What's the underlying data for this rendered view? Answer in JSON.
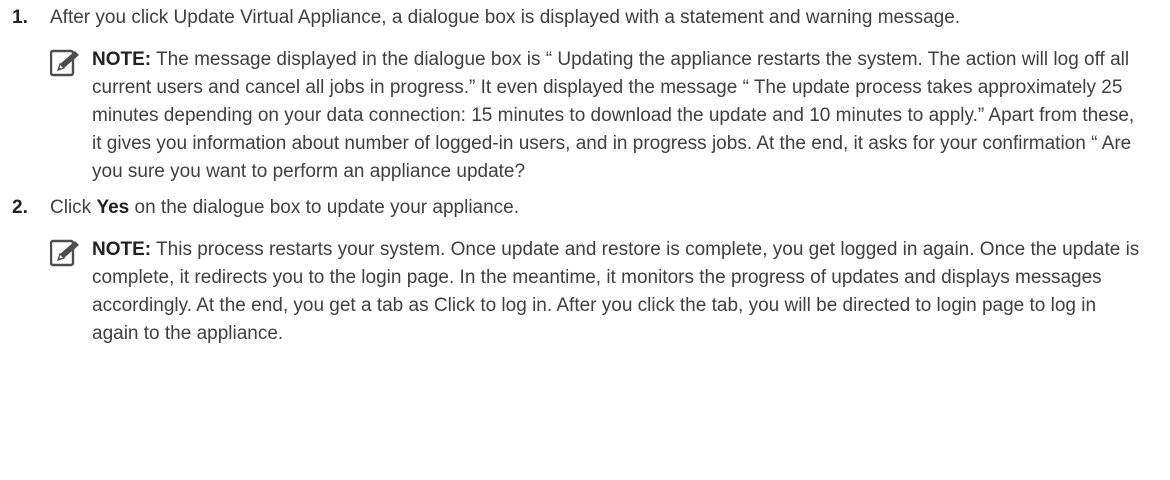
{
  "steps": [
    {
      "number": "1.",
      "text": "After you click Update Virtual Appliance, a dialogue box is displayed with a statement and warning message.",
      "note": {
        "label": "NOTE:",
        "text": " The message displayed in the dialogue box is “ Updating the appliance restarts the system. The action will log off all current users and cancel all jobs in progress.” It even displayed the message “ The update process takes approximately 25 minutes depending on your data connection: 15 minutes to download the update and 10 minutes to apply.” Apart from these, it gives you information about number of logged-in users, and in progress jobs. At the end, it asks for your confirmation “ Are you sure you want to perform an appliance update?"
      }
    },
    {
      "number": "2.",
      "text_before": "Click ",
      "bold": "Yes",
      "text_after": " on the dialogue box to update your appliance.",
      "note": {
        "label": "NOTE:",
        "text": " This process restarts your system. Once update and restore is complete, you get logged in again. Once the update is complete, it redirects you to the login page. In the meantime, it monitors the progress of updates and displays messages accordingly. At the end, you get a tab as Click to log in. After you click the tab, you will be directed to login page to log in again to the appliance."
      }
    }
  ],
  "icons": {
    "note": "pencil-note-icon"
  }
}
